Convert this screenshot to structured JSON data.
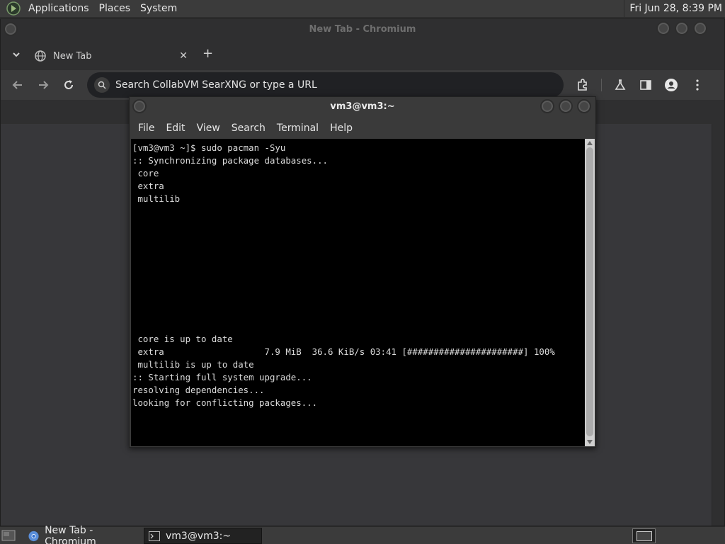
{
  "top_panel": {
    "menus": [
      "Applications",
      "Places",
      "System"
    ],
    "clock": "Fri Jun 28,  8:39 PM"
  },
  "chromium": {
    "window_title": "New Tab - Chromium",
    "tab_label": "New Tab",
    "omnibox_placeholder": "Search CollabVM SearXNG or type a URL"
  },
  "terminal": {
    "window_title": "vm3@vm3:~",
    "menus": [
      "File",
      "Edit",
      "View",
      "Search",
      "Terminal",
      "Help"
    ],
    "lines": [
      "[vm3@vm3 ~]$ sudo pacman -Syu",
      ":: Synchronizing package databases...",
      " core",
      " extra",
      " multilib",
      "",
      "",
      "",
      "",
      "",
      "",
      "",
      "",
      "",
      "",
      " core is up to date",
      " extra                   7.9 MiB  36.6 KiB/s 03:41 [######################] 100%",
      " multilib is up to date",
      ":: Starting full system upgrade...",
      "resolving dependencies...",
      "looking for conflicting packages..."
    ]
  },
  "taskbar": {
    "tasks": [
      {
        "label": "New Tab - Chromium",
        "icon": "chromium-icon"
      },
      {
        "label": "vm3@vm3:~",
        "icon": "terminal-icon"
      }
    ]
  },
  "colors": {
    "panel": "#3b3b3b",
    "terminal_bg": "#000000",
    "omnibox_bg": "#202124"
  }
}
